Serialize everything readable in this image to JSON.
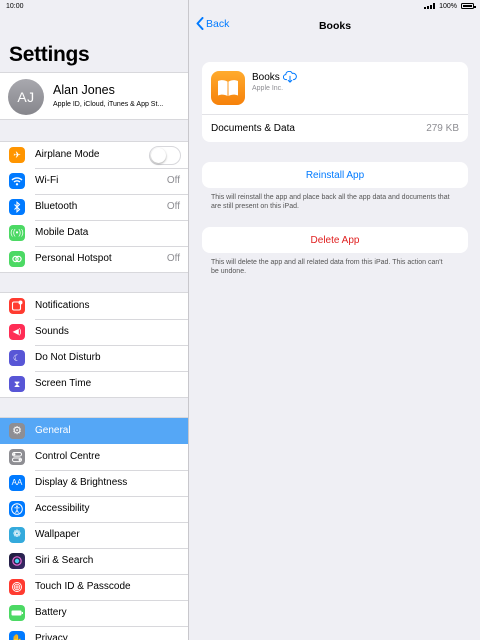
{
  "status": {
    "time": "10:00",
    "battery": "100%"
  },
  "sidebar": {
    "title": "Settings",
    "profile": {
      "initials": "AJ",
      "name": "Alan Jones",
      "subtitle": "Apple ID, iCloud, iTunes & App St..."
    },
    "groups": [
      [
        {
          "label": "Airplane Mode",
          "icon": "airplane-icon",
          "color": "#ff9500",
          "toggle": "off"
        },
        {
          "label": "Wi-Fi",
          "value": "Off",
          "icon": "wifi-icon",
          "color": "#007aff"
        },
        {
          "label": "Bluetooth",
          "value": "Off",
          "icon": "bluetooth-icon",
          "color": "#007aff"
        },
        {
          "label": "Mobile Data",
          "icon": "antenna-icon",
          "color": "#4cd964"
        },
        {
          "label": "Personal Hotspot",
          "value": "Off",
          "icon": "hotspot-icon",
          "color": "#4cd964"
        }
      ],
      [
        {
          "label": "Notifications",
          "icon": "notifications-icon",
          "color": "#ff3b30"
        },
        {
          "label": "Sounds",
          "icon": "speaker-icon",
          "color": "#ff2d55"
        },
        {
          "label": "Do Not Disturb",
          "icon": "moon-icon",
          "color": "#5856d6"
        },
        {
          "label": "Screen Time",
          "icon": "hourglass-icon",
          "color": "#5856d6"
        }
      ],
      [
        {
          "label": "General",
          "icon": "gear-icon",
          "color": "#8e8e93",
          "selected": true
        },
        {
          "label": "Control Centre",
          "icon": "switches-icon",
          "color": "#8e8e93"
        },
        {
          "label": "Display & Brightness",
          "icon": "text-size-icon",
          "color": "#007aff"
        },
        {
          "label": "Accessibility",
          "icon": "accessibility-icon",
          "color": "#007aff"
        },
        {
          "label": "Wallpaper",
          "icon": "flower-icon",
          "color": "#34aadc"
        },
        {
          "label": "Siri & Search",
          "icon": "siri-icon",
          "color": "#1c1c3a"
        },
        {
          "label": "Touch ID & Passcode",
          "icon": "fingerprint-icon",
          "color": "#ff3b30"
        },
        {
          "label": "Battery",
          "icon": "battery-icon",
          "color": "#4cd964"
        },
        {
          "label": "Privacy",
          "icon": "hand-icon",
          "color": "#007aff"
        }
      ]
    ]
  },
  "detail": {
    "back_label": "Back",
    "title": "Books",
    "app": {
      "name": "Books",
      "developer": "Apple Inc.",
      "docs_label": "Documents & Data",
      "docs_value": "279 KB"
    },
    "reinstall_label": "Reinstall App",
    "reinstall_note": "This will reinstall the app and place back all the app data and documents that are still present on this iPad.",
    "delete_label": "Delete App",
    "delete_note": "This will delete the app and all related data from this iPad. This action can't be undone."
  }
}
